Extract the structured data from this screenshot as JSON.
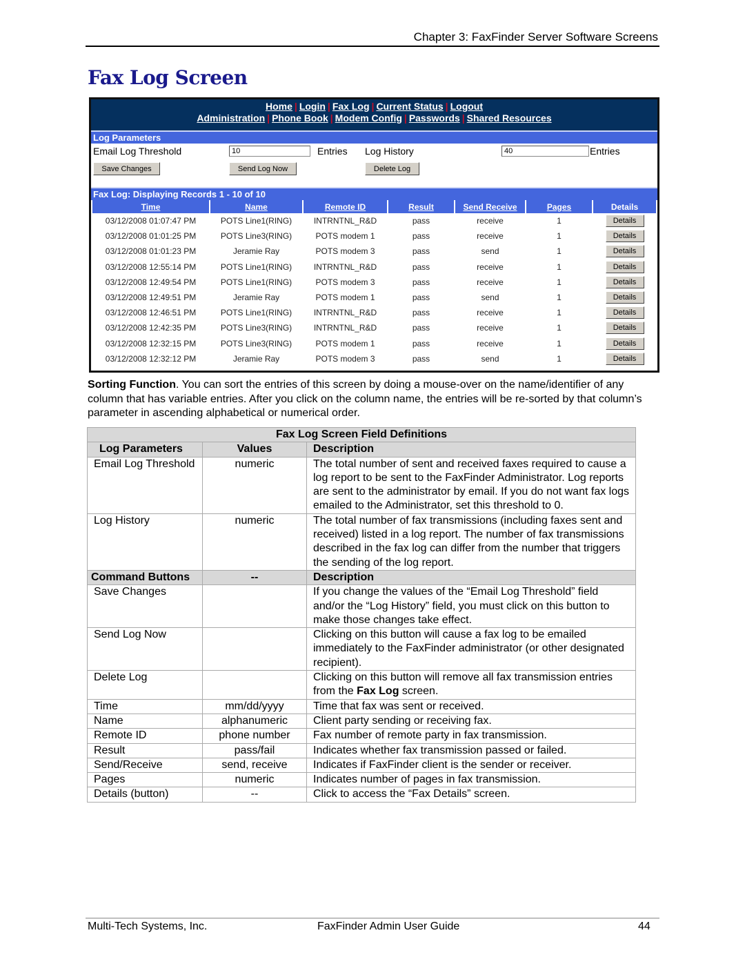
{
  "doc": {
    "chapter_header": "Chapter 3: FaxFinder Server Software Screens",
    "page_title": "Fax Log Screen",
    "footer_left": "Multi-Tech Systems, Inc.",
    "footer_center": "FaxFinder Admin User Guide",
    "footer_page": "44"
  },
  "screen": {
    "nav_row1": [
      "Home",
      "Login",
      "Fax Log",
      "Current Status",
      "Logout"
    ],
    "nav_row2": [
      "Administration",
      "Phone Book",
      "Modem Config",
      "Passwords",
      "Shared Resources"
    ],
    "log_params_title": "Log Parameters",
    "email_threshold_label": "Email Log Threshold",
    "email_threshold_value": "10",
    "entries_label": "Entries",
    "log_history_label": "Log History",
    "log_history_value": "40",
    "save_changes": "Save Changes",
    "send_log_now": "Send Log Now",
    "delete_log": "Delete Log",
    "fax_log_title": "Fax Log: Displaying Records 1 - 10 of 10",
    "columns": [
      "Time",
      "Name",
      "Remote ID",
      "Result",
      "Send Receive",
      "Pages",
      "Details"
    ],
    "details_button": "Details",
    "rows": [
      [
        "03/12/2008 01:07:47 PM",
        "POTS Line1(RING)",
        "INTRNTNL_R&D",
        "pass",
        "receive",
        "1"
      ],
      [
        "03/12/2008 01:01:25 PM",
        "POTS Line3(RING)",
        "POTS modem 1",
        "pass",
        "receive",
        "1"
      ],
      [
        "03/12/2008 01:01:23 PM",
        "Jeramie Ray",
        "POTS modem 3",
        "pass",
        "send",
        "1"
      ],
      [
        "03/12/2008 12:55:14 PM",
        "POTS Line1(RING)",
        "INTRNTNL_R&D",
        "pass",
        "receive",
        "1"
      ],
      [
        "03/12/2008 12:49:54 PM",
        "POTS Line1(RING)",
        "POTS modem 3",
        "pass",
        "receive",
        "1"
      ],
      [
        "03/12/2008 12:49:51 PM",
        "Jeramie Ray",
        "POTS modem 1",
        "pass",
        "send",
        "1"
      ],
      [
        "03/12/2008 12:46:51 PM",
        "POTS Line1(RING)",
        "INTRNTNL_R&D",
        "pass",
        "receive",
        "1"
      ],
      [
        "03/12/2008 12:42:35 PM",
        "POTS Line3(RING)",
        "INTRNTNL_R&D",
        "pass",
        "receive",
        "1"
      ],
      [
        "03/12/2008 12:32:15 PM",
        "POTS Line3(RING)",
        "POTS modem 1",
        "pass",
        "receive",
        "1"
      ],
      [
        "03/12/2008 12:32:12 PM",
        "Jeramie Ray",
        "POTS modem 3",
        "pass",
        "send",
        "1"
      ]
    ]
  },
  "sorting": {
    "lead": "Sorting Function",
    "text": ".  You can sort the entries of this screen by doing a mouse-over on the name/identifier of any column that has variable entries.  After you click on the column name, the entries will be re-sorted by that column’s parameter in ascending alphabetical or numerical order."
  },
  "defs": {
    "caption": "Fax Log Screen Field Definitions",
    "header1": [
      "Log Parameters",
      "Values",
      "Description"
    ],
    "group1": [
      [
        "Email Log Threshold",
        "numeric",
        "The total number of sent and received faxes required to cause a log report to be sent to the FaxFinder Administrator.  Log reports are sent to the administrator by email.  If you do not want fax logs emailed to the Administrator, set this threshold to 0."
      ],
      [
        "Log History",
        "numeric",
        "The total number of fax transmissions (including faxes sent and received) listed in a log report.  The number of fax transmissions described in the fax log can differ from the number that triggers the sending of the log report."
      ]
    ],
    "header2": [
      "Command Buttons",
      "--",
      "Description"
    ],
    "group2": [
      [
        "Save Changes",
        "",
        "If you change the values of the “Email Log Threshold” field and/or the “Log History” field, you must click on this button to make those changes take effect."
      ],
      [
        "Send Log Now",
        "",
        "Clicking on this button will cause a fax log to be emailed immediately to the FaxFinder administrator (or other designated recipient)."
      ],
      [
        "Delete Log",
        "",
        "Clicking on this button will remove all fax transmission entries from the ",
        "Fax Log",
        " screen."
      ],
      [
        "Time",
        "mm/dd/yyyy",
        "Time that fax was sent or received."
      ],
      [
        "Name",
        "alphanumeric",
        "Client party sending or receiving fax."
      ],
      [
        "Remote ID",
        "phone number",
        "Fax number of remote party in fax transmission."
      ],
      [
        "Result",
        "pass/fail",
        "Indicates whether fax transmission passed or failed."
      ],
      [
        "Send/Receive",
        "send, receive",
        "Indicates if FaxFinder client is the sender or receiver."
      ],
      [
        "Pages",
        "numeric",
        "Indicates number of pages in fax transmission."
      ],
      [
        "Details  (button)",
        "--",
        "Click to access the “Fax Details” screen."
      ]
    ]
  }
}
